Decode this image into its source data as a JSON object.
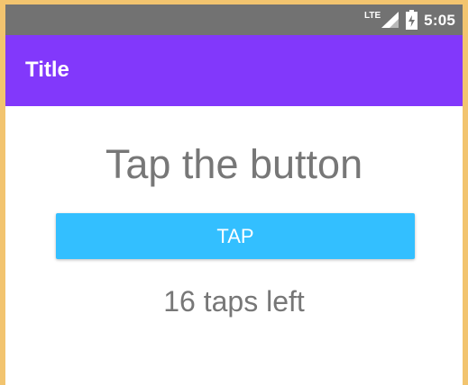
{
  "status_bar": {
    "network_label": "LTE",
    "time": "5:05",
    "signal_icon": "signal-icon",
    "battery_icon": "battery-charging-icon"
  },
  "app_bar": {
    "title": "Title",
    "color": "#8238fb"
  },
  "main": {
    "instruction": "Tap the button",
    "button_label": "TAP",
    "taps_left": "16 taps left",
    "button_color": "#33bfff"
  }
}
